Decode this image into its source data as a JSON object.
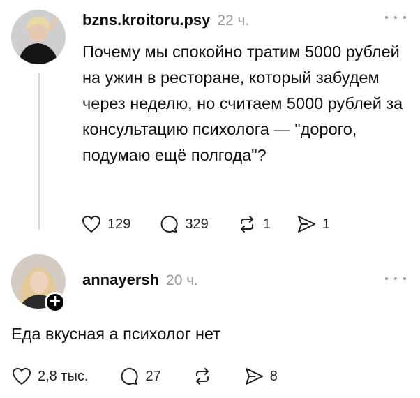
{
  "posts": [
    {
      "username": "bzns.kroitoru.psy",
      "time": "22 ч.",
      "text": "Почему мы спокойно тратим 5000 рублей на ужин в ресторане, который забудем через неделю, но считаем 5000 рублей за консультацию психолога — \"дорого, подумаю ещё полгода\"?",
      "likes": "129",
      "comments": "329",
      "reposts": "1",
      "shares": "1"
    },
    {
      "username": "annayersh",
      "time": "20 ч.",
      "text": "Еда вкусная а психолог нет",
      "likes": "2,8 тыс.",
      "comments": "27",
      "reposts": "",
      "shares": "8"
    }
  ],
  "icons": {
    "like": "heart-icon",
    "comment": "comment-icon",
    "repost": "repost-icon",
    "share": "share-icon",
    "more": "more-icon",
    "follow": "plus-icon"
  },
  "follow_badge": "+"
}
